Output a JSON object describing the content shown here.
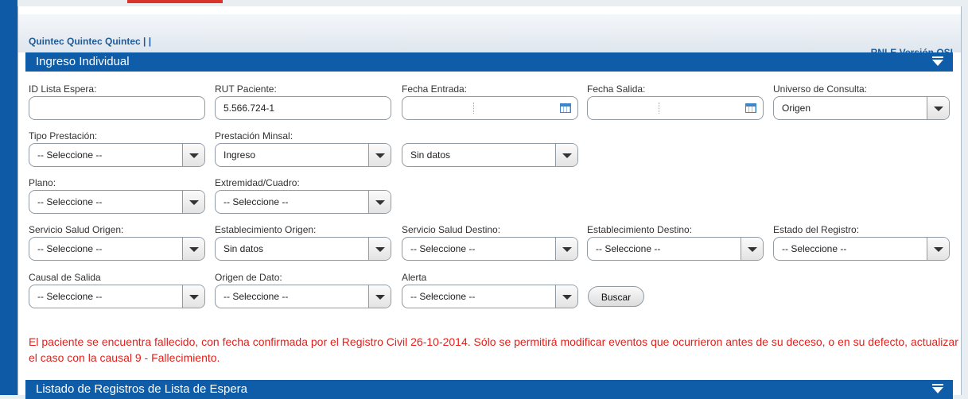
{
  "header": {
    "brand": "Quintec Quintec Quintec | |",
    "version": "RNLE Versión QSI"
  },
  "panel": {
    "title": "Ingreso Individual"
  },
  "fields": {
    "id_lista_espera": {
      "label": "ID Lista Espera:",
      "value": ""
    },
    "rut_paciente": {
      "label": "RUT Paciente:",
      "value": "5.566.724-1"
    },
    "fecha_entrada": {
      "label": "Fecha Entrada:",
      "value": ""
    },
    "fecha_salida": {
      "label": "Fecha Salida:",
      "value": ""
    },
    "universo_consulta": {
      "label": "Universo de Consulta:",
      "value": "Origen"
    },
    "tipo_prestacion": {
      "label": "Tipo Prestación:",
      "value": "-- Seleccione --"
    },
    "prestacion_minsal": {
      "label": "Prestación Minsal:",
      "value": "Ingreso"
    },
    "prestacion_detalle": {
      "value": "Sin datos"
    },
    "plano": {
      "label": "Plano:",
      "value": "-- Seleccione --"
    },
    "extremidad_cuadro": {
      "label": "Extremidad/Cuadro:",
      "value": "-- Seleccione --"
    },
    "servicio_salud_origen": {
      "label": "Servicio Salud Origen:",
      "value": "-- Seleccione --"
    },
    "establecimiento_origen": {
      "label": "Establecimiento Origen:",
      "value": "Sin datos"
    },
    "servicio_salud_destino": {
      "label": "Servicio Salud Destino:",
      "value": "-- Seleccione --"
    },
    "establecimiento_destino": {
      "label": "Establecimiento Destino:",
      "value": "-- Seleccione --"
    },
    "estado_registro": {
      "label": "Estado del Registro:",
      "value": "-- Seleccione --"
    },
    "causal_salida": {
      "label": "Causal de Salida",
      "value": "-- Seleccione --"
    },
    "origen_dato": {
      "label": "Origen de Dato:",
      "value": "-- Seleccione --"
    },
    "alerta": {
      "label": "Alerta",
      "value": "-- Seleccione --"
    }
  },
  "buttons": {
    "buscar": "Buscar"
  },
  "warning": "El paciente se encuentra fallecido, con fecha confirmada por el Registro Civil 26-10-2014. Sólo se permitirá modificar eventos que ocurrieron antes de su deceso, o en su defecto, actualizar el caso con la causal 9 - Fallecimiento.",
  "list_panel": {
    "title": "Listado de Registros de Lista de Espera"
  },
  "colors": {
    "accent": "#0f5ca8",
    "warning": "#e3201b",
    "brand": "#1d5c9c"
  },
  "icons": {
    "calendar": "calendar-icon",
    "collapse": "collapse-icon",
    "dropdown": "chevron-down-icon"
  }
}
